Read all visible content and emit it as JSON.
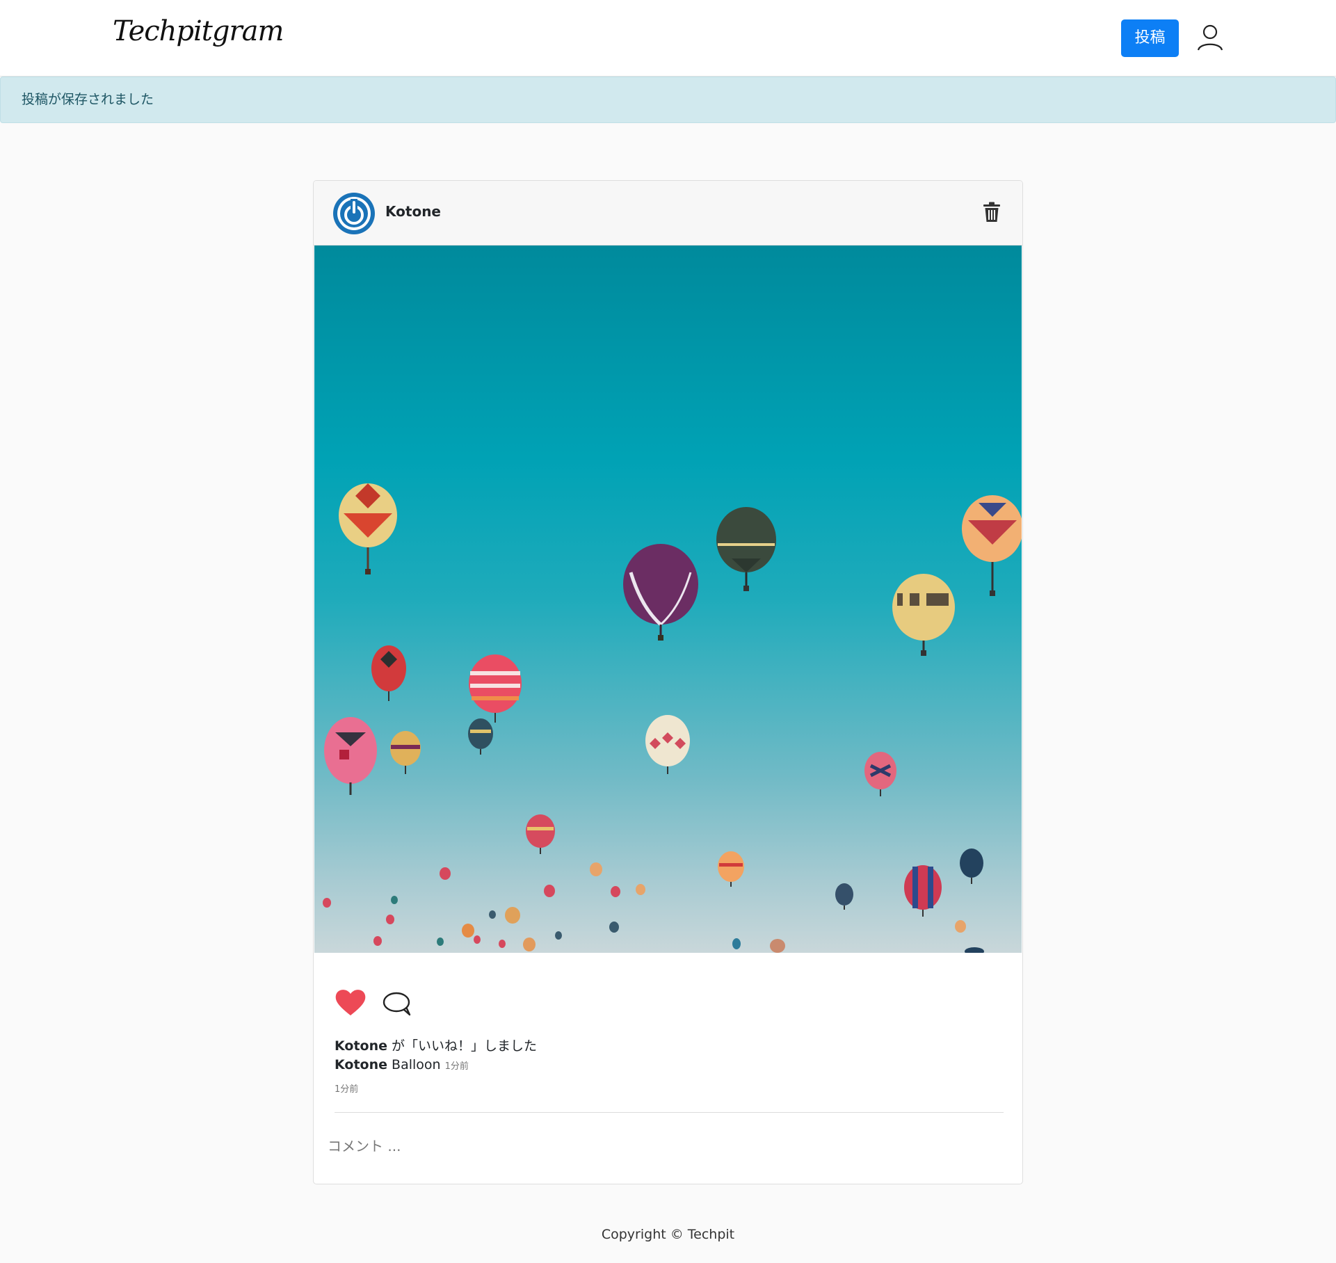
{
  "header": {
    "logo_text": "Techpitgram",
    "post_button_label": "投稿",
    "user_icon": "user-icon"
  },
  "alert": {
    "message": "投稿が保存されました"
  },
  "post": {
    "username": "Kotone",
    "avatar_icon": "power-icon",
    "delete_icon": "trash-icon",
    "photo_alt": "Balloon",
    "like_icon": "heart-icon",
    "comment_icon": "comment-icon",
    "like_user": "Kotone",
    "like_text": " が「いいね！」しました",
    "caption_user": "Kotone",
    "caption_text": " Balloon ",
    "caption_time": "1分前",
    "post_time": "1分前",
    "comment_placeholder": "コメント ..."
  },
  "footer": {
    "copyright": "Copyright © Techpit"
  },
  "colors": {
    "accent": "#0d7ff5",
    "heart": "#ed4956",
    "alert_bg": "#d1e9ee",
    "alert_text": "#1e5664",
    "avatar_blue": "#1a73b8"
  }
}
